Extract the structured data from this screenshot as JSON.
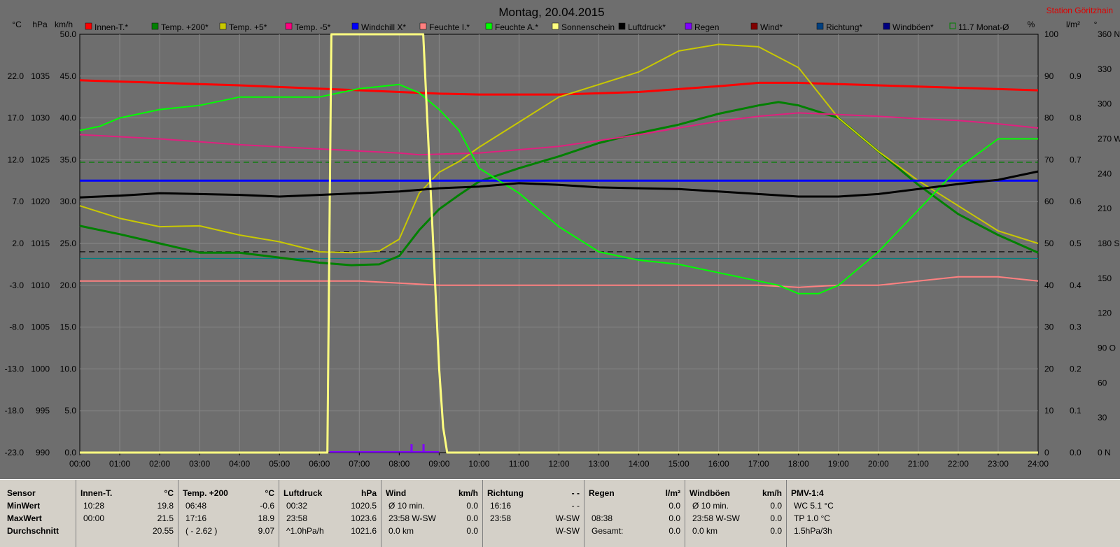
{
  "header": {
    "title": "Montag, 20.04.2015",
    "station": "Station Göritzhain",
    "left_axis_units": [
      "°C",
      "hPa",
      "km/h"
    ],
    "right_axis_units": [
      "%",
      "l/m²",
      "°"
    ]
  },
  "legend": [
    {
      "label": "Innen-T.*",
      "color": "#ff0000"
    },
    {
      "label": "Temp. +200*",
      "color": "#008000"
    },
    {
      "label": "Temp. +5*",
      "color": "#c8c800"
    },
    {
      "label": "Temp. -5*",
      "color": "#ff0080"
    },
    {
      "label": "Windchill X*",
      "color": "#0000ff"
    },
    {
      "label": "Feuchte I.*",
      "color": "#ff8080"
    },
    {
      "label": "Feuchte A.*",
      "color": "#00ff00"
    },
    {
      "label": "Sonnenschein",
      "color": "#ffff80"
    },
    {
      "label": "Luftdruck*",
      "color": "#000000"
    },
    {
      "label": "Regen",
      "color": "#8000ff"
    },
    {
      "label": "Wind*",
      "color": "#800000"
    },
    {
      "label": "Richtung*",
      "color": "#004080"
    },
    {
      "label": "Windböen*",
      "color": "#000080"
    },
    {
      "label": "11.7 Monat-Ø",
      "color": "#008000"
    }
  ],
  "chart_data": {
    "type": "line",
    "title": "Montag, 20.04.2015",
    "x_label": "",
    "x_ticks": [
      "00:00",
      "01:00",
      "02:00",
      "03:00",
      "04:00",
      "05:00",
      "06:00",
      "07:00",
      "08:00",
      "09:00",
      "10:00",
      "11:00",
      "12:00",
      "13:00",
      "14:00",
      "15:00",
      "16:00",
      "17:00",
      "18:00",
      "19:00",
      "20:00",
      "21:00",
      "22:00",
      "23:00",
      "24:00"
    ],
    "xlim": [
      0,
      24
    ],
    "axes": {
      "temp_c": {
        "ticks": [
          "-23.0",
          "-18.0",
          "-13.0",
          "-8.0",
          "-3.0",
          "2.0",
          "7.0",
          "12.0",
          "17.0",
          "22.0"
        ],
        "range": [
          -23,
          27
        ]
      },
      "pressure_hpa": {
        "ticks": [
          "990",
          "995",
          "1000",
          "1005",
          "1010",
          "1015",
          "1020",
          "1025",
          "1030",
          "1035"
        ],
        "range": [
          990,
          1040
        ]
      },
      "speed_kmh": {
        "ticks": [
          "0.0",
          "5.0",
          "10.0",
          "15.0",
          "20.0",
          "25.0",
          "30.0",
          "35.0",
          "40.0",
          "45.0",
          "50.0"
        ],
        "range": [
          0,
          50
        ]
      },
      "percent": {
        "ticks": [
          "0",
          "10",
          "20",
          "30",
          "40",
          "50",
          "60",
          "70",
          "80",
          "90",
          "100"
        ],
        "range": [
          0,
          100
        ]
      },
      "rain_lm2": {
        "ticks": [
          "0.0",
          "0.1",
          "0.2",
          "0.3",
          "0.4",
          "0.5",
          "0.6",
          "0.7",
          "0.8",
          "0.9"
        ],
        "range": [
          0,
          1.0
        ]
      },
      "direction_deg": {
        "ticks": [
          "0 N",
          "30",
          "60",
          "90 O",
          "120",
          "150",
          "180 S",
          "210",
          "240",
          "270 W",
          "300",
          "330",
          "360 N"
        ],
        "range": [
          0,
          360
        ]
      }
    },
    "series": [
      {
        "name": "Innen-T.*",
        "color": "#ff0000",
        "axis": "temp_c",
        "width": 3,
        "x": [
          0,
          2,
          4,
          6,
          8,
          9,
          10,
          12,
          14,
          16,
          17,
          18,
          20,
          22,
          24
        ],
        "y": [
          21.5,
          21.2,
          20.9,
          20.5,
          20.1,
          19.9,
          19.8,
          19.8,
          20.1,
          20.8,
          21.2,
          21.2,
          20.9,
          20.6,
          20.3
        ]
      },
      {
        "name": "Temp. +200*",
        "color": "#008000",
        "axis": "temp_c",
        "width": 3,
        "x": [
          0,
          1,
          2,
          3,
          4,
          5,
          6,
          6.8,
          7.5,
          8,
          8.5,
          9,
          9.5,
          10,
          11,
          12,
          13,
          14,
          15,
          16,
          17,
          17.5,
          18,
          19,
          20,
          21,
          22,
          23,
          24
        ],
        "y": [
          4.1,
          3.1,
          2.0,
          0.9,
          0.9,
          0.3,
          -0.3,
          -0.6,
          -0.5,
          0.5,
          3.6,
          6.1,
          7.8,
          9.4,
          11.0,
          12.4,
          14.0,
          15.2,
          16.2,
          17.5,
          18.5,
          18.9,
          18.5,
          17.0,
          13.0,
          9.0,
          5.5,
          3.0,
          0.9
        ]
      },
      {
        "name": "Temp. +5*",
        "color": "#c8c800",
        "axis": "temp_c",
        "width": 2,
        "x": [
          0,
          1,
          2,
          3,
          4,
          5,
          6,
          6.8,
          7.5,
          8,
          8.5,
          9,
          9.5,
          10,
          11,
          12,
          13,
          14,
          15,
          16,
          17,
          18,
          19,
          20,
          21,
          22,
          23,
          24
        ],
        "y": [
          6.5,
          5.0,
          4.0,
          4.1,
          3.0,
          2.2,
          1.0,
          0.9,
          1.1,
          2.5,
          8.0,
          10.5,
          11.8,
          13.5,
          16.5,
          19.5,
          21.0,
          22.5,
          25.0,
          25.8,
          25.5,
          23.0,
          17.0,
          13.0,
          9.5,
          6.5,
          3.5,
          2.0
        ]
      },
      {
        "name": "Temp. -5*",
        "color": "#e0207f",
        "axis": "temp_c",
        "width": 2,
        "x": [
          0,
          2,
          4,
          6,
          8,
          8.5,
          10,
          12,
          14,
          16,
          17,
          18,
          19,
          20,
          21,
          22,
          23,
          24
        ],
        "y": [
          15.0,
          14.5,
          13.8,
          13.3,
          12.8,
          12.6,
          12.8,
          13.6,
          15.0,
          16.6,
          17.2,
          17.6,
          17.4,
          17.2,
          16.9,
          16.7,
          16.3,
          15.8
        ]
      },
      {
        "name": "Windchill X*",
        "color": "#0000ff",
        "axis": "temp_c",
        "width": 3,
        "x": [
          0,
          24
        ],
        "y": [
          9.5,
          9.5
        ]
      },
      {
        "name": "Feuchte I.*",
        "color": "#ff8080",
        "axis": "percent",
        "width": 2,
        "x": [
          0,
          2,
          4,
          6,
          7,
          8,
          9,
          10,
          12,
          14,
          16,
          17,
          18,
          19,
          20,
          21,
          22,
          23,
          24
        ],
        "y": [
          41,
          41,
          41,
          41,
          41,
          40.5,
          40,
          40,
          40,
          40,
          40,
          40,
          39.5,
          40,
          40,
          41,
          42,
          42,
          41
        ]
      },
      {
        "name": "Feuchte A.*",
        "color": "#00ff00",
        "axis": "percent",
        "width": 2,
        "x": [
          0,
          0.5,
          1,
          2,
          3,
          4,
          5,
          6,
          6.5,
          7,
          8,
          8.5,
          9,
          9.5,
          10,
          11,
          12,
          13,
          14,
          15,
          16,
          17,
          17.5,
          18,
          18.5,
          19,
          20,
          21,
          22,
          23,
          24
        ],
        "y": [
          77,
          78,
          80,
          82,
          83,
          85,
          85,
          85,
          86,
          87,
          88,
          86,
          82,
          77,
          68,
          62,
          54,
          48,
          46,
          45,
          43,
          41,
          40,
          38,
          38,
          40,
          48,
          58,
          68,
          75,
          75
        ]
      },
      {
        "name": "Sonnenschein",
        "color": "#ffff80",
        "axis": "speed_kmh",
        "width": 3,
        "x": [
          0,
          6.2,
          6.25,
          6.3,
          8.6,
          8.8,
          8.9,
          9.0,
          9.1,
          9.2,
          24
        ],
        "y": [
          0,
          0,
          25,
          50,
          50,
          30,
          20,
          10,
          3,
          0,
          0
        ]
      },
      {
        "name": "Luftdruck*",
        "color": "#000000",
        "axis": "pressure_hpa",
        "width": 3,
        "x": [
          0,
          1,
          2,
          3,
          4,
          5,
          6,
          7,
          8,
          9,
          10,
          11,
          12,
          13,
          14,
          15,
          16,
          17,
          18,
          19,
          20,
          21,
          22,
          23,
          24
        ],
        "y": [
          1020.5,
          1020.7,
          1021.0,
          1020.9,
          1020.8,
          1020.6,
          1020.8,
          1021.0,
          1021.2,
          1021.6,
          1021.8,
          1022.2,
          1022.0,
          1021.7,
          1021.6,
          1021.5,
          1021.2,
          1020.9,
          1020.6,
          1020.6,
          1020.9,
          1021.5,
          1022.1,
          1022.6,
          1023.6
        ]
      }
    ],
    "reference_lines": [
      {
        "axis": "temp_c",
        "value": 11.7,
        "color": "#008000",
        "style": "dashed"
      },
      {
        "axis": "temp_c",
        "value": 1.0,
        "color": "#000000",
        "style": "dashed"
      },
      {
        "axis": "temp_c",
        "value": 0.2,
        "color": "#008080",
        "style": "solid"
      }
    ],
    "rain_bars": {
      "color": "#8000ff",
      "axis": "rain_lm2",
      "x": [
        8.3,
        8.6
      ],
      "values": [
        0.02,
        0.02
      ]
    },
    "grid": true
  },
  "stats": {
    "row_labels": [
      "Sensor",
      "MinWert",
      "MaxWert",
      "Durchschnitt"
    ],
    "columns": [
      {
        "title": "Innen-T.",
        "unit": "°C",
        "rows": [
          [
            "10:28",
            "19.8"
          ],
          [
            "00:00",
            "21.5"
          ],
          [
            "",
            "20.55"
          ]
        ]
      },
      {
        "title": "Temp. +200",
        "unit": "°C",
        "rows": [
          [
            "06:48",
            "-0.6"
          ],
          [
            "17:16",
            "18.9"
          ],
          [
            "( - 2.62 )",
            "9.07"
          ]
        ]
      },
      {
        "title": "Luftdruck",
        "unit": "hPa",
        "rows": [
          [
            "00:32",
            "1020.5"
          ],
          [
            "23:58",
            "1023.6"
          ],
          [
            "^1.0hPa/h",
            "1021.6"
          ]
        ]
      },
      {
        "title": "Wind",
        "unit": "km/h",
        "rows": [
          [
            "Ø 10 min.",
            "0.0"
          ],
          [
            "23:58  W-SW",
            "0.0"
          ],
          [
            "0.0 km",
            "0.0"
          ]
        ]
      },
      {
        "title": "Richtung",
        "unit": "- -",
        "rows": [
          [
            "16:16",
            "- -"
          ],
          [
            "23:58",
            "W-SW"
          ],
          [
            "",
            "W-SW"
          ]
        ]
      },
      {
        "title": "Regen",
        "unit": "l/m²",
        "rows": [
          [
            "",
            "0.0"
          ],
          [
            "08:38",
            "0.0"
          ],
          [
            "Gesamt:",
            "0.0"
          ]
        ]
      },
      {
        "title": "Windböen",
        "unit": "km/h",
        "rows": [
          [
            "Ø 10 min.",
            "0.0"
          ],
          [
            "23:58  W-SW",
            "0.0"
          ],
          [
            "0.0 km",
            "0.0"
          ]
        ]
      },
      {
        "title": "PMV-1:4",
        "unit": "",
        "rows": [
          [
            "WC 5.1 °C",
            ""
          ],
          [
            "TP 1.0 °C",
            ""
          ],
          [
            "1.5hPa/3h",
            ""
          ]
        ]
      }
    ]
  }
}
